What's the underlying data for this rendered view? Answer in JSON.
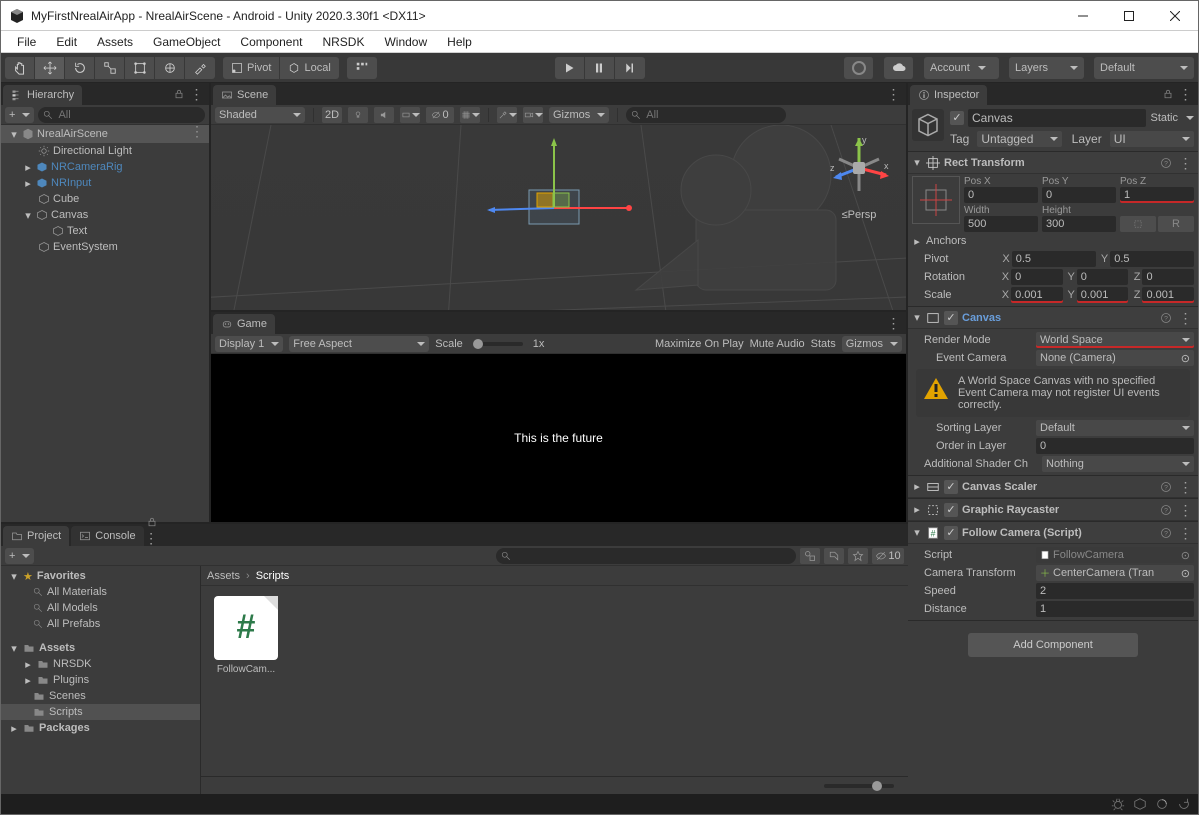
{
  "window": {
    "title": "MyFirstNrealAirApp - NrealAirScene - Android - Unity 2020.3.30f1 <DX11>"
  },
  "menu": [
    "File",
    "Edit",
    "Assets",
    "GameObject",
    "Component",
    "NRSDK",
    "Window",
    "Help"
  ],
  "toolbar": {
    "pivot": "Pivot",
    "local": "Local",
    "account": "Account",
    "layers": "Layers",
    "layout": "Default"
  },
  "hierarchy": {
    "tab": "Hierarchy",
    "search_placeholder": "All",
    "scene": "NrealAirScene",
    "items": [
      {
        "label": "Directional Light",
        "type": "light"
      },
      {
        "label": "NRCameraRig",
        "type": "prefab",
        "linked": true,
        "expandable": true
      },
      {
        "label": "NRInput",
        "type": "prefab",
        "linked": true,
        "expandable": true
      },
      {
        "label": "Cube",
        "type": "mesh"
      },
      {
        "label": "Canvas",
        "type": "ui",
        "expandable": true,
        "expanded": true
      },
      {
        "label": "Text",
        "type": "ui"
      },
      {
        "label": "EventSystem",
        "type": "go"
      }
    ]
  },
  "scene": {
    "tab": "Scene",
    "shading": "Shaded",
    "mode2d": "2D",
    "zeroOf3": "0",
    "gizmos": "Gizmos",
    "search_placeholder": "All",
    "persp": "≤Persp"
  },
  "game": {
    "tab": "Game",
    "display": "Display 1",
    "aspect": "Free Aspect",
    "scale_label": "Scale",
    "scale_value": "1x",
    "maximize": "Maximize On Play",
    "mute": "Mute Audio",
    "stats": "Stats",
    "gizmos": "Gizmos",
    "content": "This is the future"
  },
  "project": {
    "tab_project": "Project",
    "tab_console": "Console",
    "search_placeholder": "",
    "hidden_count": "10",
    "tree": {
      "favorites": "Favorites",
      "fav_items": [
        "All Materials",
        "All Models",
        "All Prefabs"
      ],
      "assets": "Assets",
      "asset_items": [
        "NRSDK",
        "Plugins",
        "Scenes",
        "Scripts"
      ],
      "packages": "Packages"
    },
    "breadcrumbs": [
      "Assets",
      "Scripts"
    ],
    "assets": [
      {
        "name": "FollowCam..."
      }
    ]
  },
  "inspector": {
    "tab": "Inspector",
    "object_name": "Canvas",
    "static": "Static",
    "tag_label": "Tag",
    "tag_value": "Untagged",
    "layer_label": "Layer",
    "layer_value": "UI",
    "rect_transform": {
      "title": "Rect Transform",
      "posX_label": "Pos X",
      "posX": "0",
      "posY_label": "Pos Y",
      "posY": "0",
      "posZ_label": "Pos Z",
      "posZ": "1",
      "width_label": "Width",
      "width": "500",
      "height_label": "Height",
      "height": "300",
      "anchors": "Anchors",
      "pivot": "Pivot",
      "pivotX": "0.5",
      "pivotY": "0.5",
      "rotation": "Rotation",
      "rotX": "0",
      "rotY": "0",
      "rotZ": "0",
      "scale": "Scale",
      "sclX": "0.001",
      "sclY": "0.001",
      "sclZ": "0.001"
    },
    "canvas": {
      "title": "Canvas",
      "render_mode_label": "Render Mode",
      "render_mode_value": "World Space",
      "event_camera_label": "Event Camera",
      "event_camera_value": "None (Camera)",
      "warning": "A World Space Canvas with no specified Event Camera may not register UI events correctly.",
      "sorting_layer_label": "Sorting Layer",
      "sorting_layer_value": "Default",
      "order_label": "Order in Layer",
      "order_value": "0",
      "shader_label": "Additional Shader Ch",
      "shader_value": "Nothing"
    },
    "canvas_scaler": {
      "title": "Canvas Scaler"
    },
    "raycaster": {
      "title": "Graphic Raycaster"
    },
    "follow_camera": {
      "title": "Follow Camera (Script)",
      "script_label": "Script",
      "script_value": "FollowCamera",
      "transform_label": "Camera Transform",
      "transform_value": "CenterCamera (Tran",
      "speed_label": "Speed",
      "speed_value": "2",
      "distance_label": "Distance",
      "distance_value": "1"
    },
    "add_component": "Add Component"
  }
}
